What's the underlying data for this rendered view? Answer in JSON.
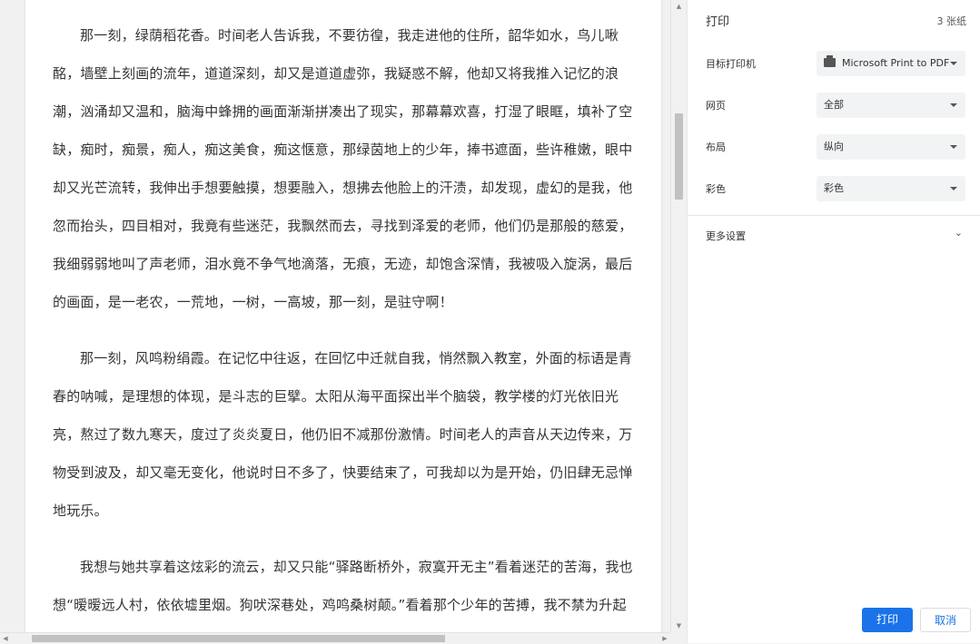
{
  "preview": {
    "paragraphs": [
      "那一刻，绿荫稻花香。时间老人告诉我，不要彷徨，我走进他的住所，韶华如水，鸟儿啾酩，墙壁上刻画的流年，道道深刻，却又是道道虚弥，我疑惑不解，他却又将我推入记忆的浪潮，汹涌却又温和，脑海中蜂拥的画面渐渐拼凑出了现实，那幕幕欢喜，打湿了眼眶，填补了空缺，痴时，痴景，痴人，痴这美食，痴这惬意，那绿茵地上的少年，捧书遮面，些许稚嫩，眼中却又光芒流转，我伸出手想要触摸，想要融入，想拂去他脸上的汗渍，却发现，虚幻的是我，他忽而抬头，四目相对，我竟有些迷茫，我飘然而去，寻找到泽爱的老师，他们仍是那般的慈爱，我细弱弱地叫了声老师，泪水竟不争气地滴落，无痕，无迹，却饱含深情，我被吸入旋涡，最后的画面，是一老农，一荒地，一树，一高坡，那一刻，是驻守啊！",
      "那一刻，风鸣粉绢霞。在记忆中往返，在回忆中迁就自我，悄然飘入教室，外面的标语是青春的呐喊，是理想的体现，是斗志的巨擘。太阳从海平面探出半个脑袋，教学楼的灯光依旧光亮，熬过了数九寒天，度过了炎炎夏日，他仍旧不减那份激情。时间老人的声音从天边传来，万物受到波及，却又毫无变化，他说时日不多了，快要结束了，可我却以为是开始，仍旧肆无忌惮地玩乐。",
      "我想与她共享着这炫彩的流云，却又只能“驿路断桥外，寂寞开无主”看着迷茫的苦海，我也想“暧暧远人村，依依墟里烟。狗吠深巷处，鸡鸣桑树颠。”看着那个少年的苦搏，我不禁为升起"
    ]
  },
  "panel": {
    "title": "打印",
    "sheets": "3 张纸",
    "destination_label": "目标打印机",
    "destination_value": "Microsoft Print to PDF",
    "pages_label": "网页",
    "pages_value": "全部",
    "layout_label": "布局",
    "layout_value": "纵向",
    "color_label": "彩色",
    "color_value": "彩色",
    "more_settings": "更多设置",
    "print_button": "打印",
    "cancel_button": "取消"
  },
  "colors": {
    "accent": "#1a73e8",
    "field_bg": "#f1f3f4"
  },
  "icons": {
    "printer": "printer-icon",
    "more": "chevron-down-icon"
  }
}
